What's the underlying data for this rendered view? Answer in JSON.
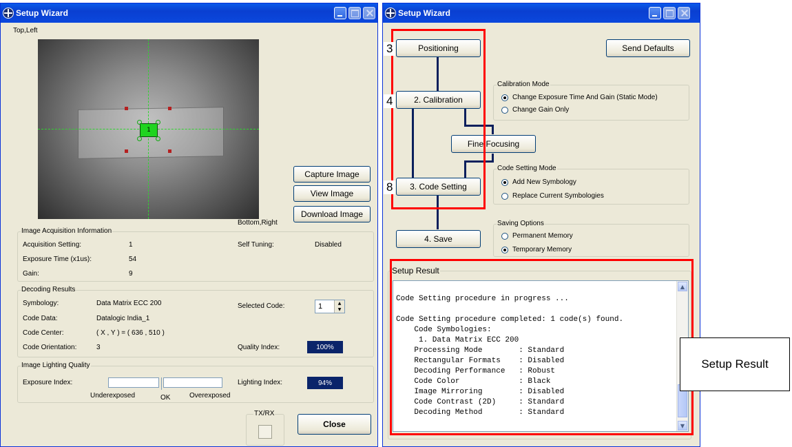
{
  "left_window": {
    "title": "Setup Wizard",
    "top_left_label": "Top,Left",
    "bottom_right_label": "Bottom,Right",
    "code_marker": "1",
    "buttons": {
      "capture": "Capture Image",
      "view": "View Image",
      "download": "Download Image",
      "close": "Close"
    },
    "acquisition": {
      "legend": "Image Acquisition Information",
      "setting_label": "Acquisition Setting:",
      "setting_value": "1",
      "exposure_label": "Exposure Time (x1us):",
      "exposure_value": "54",
      "gain_label": "Gain:",
      "gain_value": "9",
      "self_tuning_label": "Self Tuning:",
      "self_tuning_value": "Disabled"
    },
    "decoding": {
      "legend": "Decoding Results",
      "symbology_label": "Symbology:",
      "symbology_value": "Data Matrix ECC 200",
      "code_data_label": "Code Data:",
      "code_data_value": "Datalogic India_1",
      "code_center_label": "Code Center:",
      "code_center_value": "( X , Y ) = ( 636 , 510 )",
      "orientation_label": "Code Orientation:",
      "orientation_value": "3",
      "selected_code_label": "Selected Code:",
      "selected_code_value": "1",
      "quality_label": "Quality Index:",
      "quality_value": "100%"
    },
    "lighting": {
      "legend": "Image Lighting Quality",
      "exposure_index_label": "Exposure Index:",
      "under_label": "Underexposed",
      "ok_label": "OK",
      "over_label": "Overexposed",
      "lighting_index_label": "Lighting Index:",
      "lighting_index_value": "94%"
    },
    "txrx_legend": "TX/RX"
  },
  "right_window": {
    "title": "Setup Wizard",
    "buttons": {
      "positioning": "Positioning",
      "calibration": "2. Calibration",
      "fine_focusing": "Fine Focusing",
      "code_setting": "3. Code Setting",
      "save": "4. Save",
      "send_defaults": "Send Defaults"
    },
    "step_numbers": {
      "positioning": "3",
      "calibration": "4",
      "code_setting": "8"
    },
    "calibration_mode": {
      "legend": "Calibration Mode",
      "option1": "Change Exposure Time And Gain (Static Mode)",
      "option2": "Change Gain Only"
    },
    "code_setting_mode": {
      "legend": "Code Setting Mode",
      "option1": "Add New Symbology",
      "option2": "Replace Current Symbologies"
    },
    "saving_options": {
      "legend": "Saving Options",
      "option1": "Permanent Memory",
      "option2": "Temporary Memory"
    },
    "setup_result": {
      "legend": "Setup Result",
      "lines": [
        "",
        "Code Setting procedure in progress ...",
        "",
        "Code Setting procedure completed: 1 code(s) found.",
        "    Code Symbologies:",
        "     1. Data Matrix ECC 200",
        "    Processing Mode        : Standard",
        "    Rectangular Formats    : Disabled",
        "    Decoding Performance   : Robust",
        "    Code Color             : Black",
        "    Image Mirroring        : Disabled",
        "    Code Contrast (2D)     : Standard",
        "    Decoding Method        : Standard"
      ]
    }
  },
  "callout": {
    "label": "Setup Result"
  },
  "colors": {
    "title_bar": "#0a4ad8",
    "window_bg": "#ece9d8",
    "highlight": "#ff0000",
    "index_badge": "#0a246a"
  }
}
